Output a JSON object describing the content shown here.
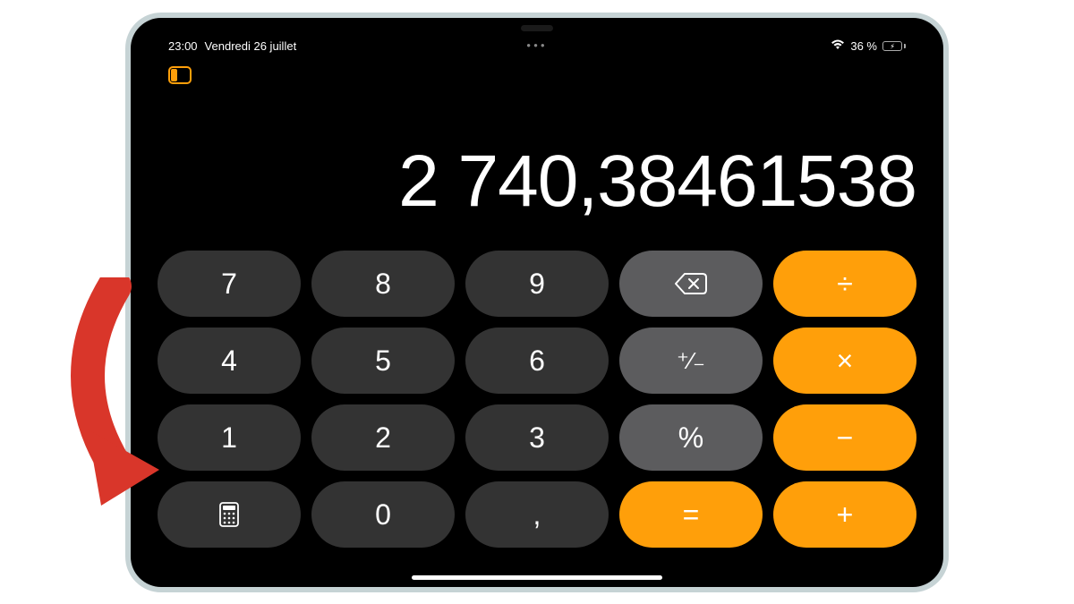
{
  "status": {
    "time": "23:00",
    "date": "Vendredi 26 juillet",
    "battery_text": "36 %",
    "battery_level": 36
  },
  "calculator": {
    "display": "2 740,38461538"
  },
  "keys": {
    "7": "7",
    "8": "8",
    "9": "9",
    "4": "4",
    "5": "5",
    "6": "6",
    "1": "1",
    "2": "2",
    "3": "3",
    "0": "0",
    "decimal": ",",
    "plusminus": "⁺∕₋",
    "percent": "%",
    "divide": "÷",
    "multiply": "×",
    "minus": "−",
    "plus": "+",
    "equals": "="
  },
  "colors": {
    "number_key": "#333333",
    "function_key": "#5c5c5e",
    "operator_key": "#ff9f0a",
    "accent_orange": "#ff9f0a",
    "arrow": "#d9362a"
  }
}
